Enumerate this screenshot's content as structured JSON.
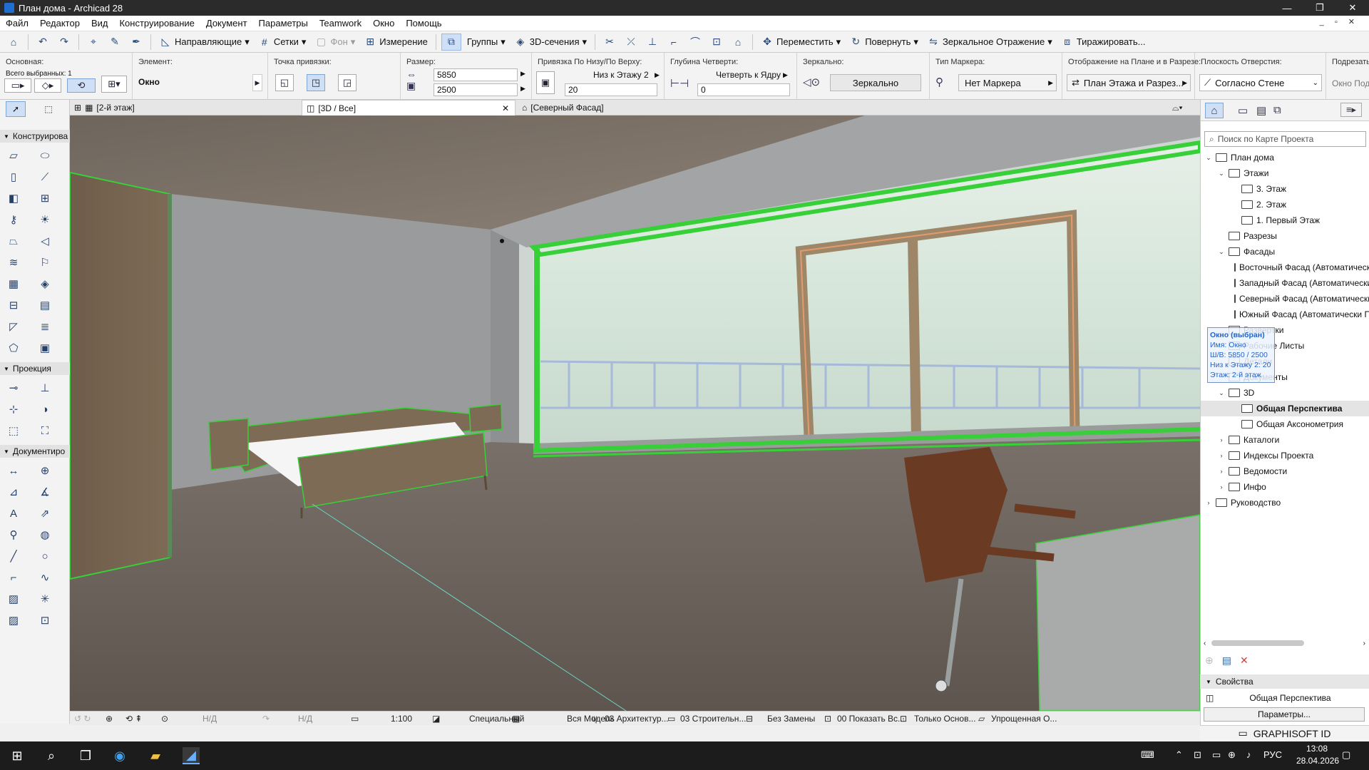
{
  "window": {
    "title": "План дома - Archicad 28",
    "controls": [
      "—",
      "❐",
      "✕"
    ]
  },
  "menu": [
    "Файл",
    "Редактор",
    "Вид",
    "Конструирование",
    "Документ",
    "Параметры",
    "Teamwork",
    "Окно",
    "Помощь"
  ],
  "menu_right": "_ ▫ ✕",
  "toolbar": {
    "guides": "Направляющие",
    "grids": "Сетки",
    "background": "Фон",
    "measure": "Измерение",
    "groups": "Группы",
    "sections3d": "3D-сечения",
    "move": "Переместить",
    "rotate": "Повернуть",
    "mirror": "Зеркальное Отражение",
    "multiply": "Тиражировать..."
  },
  "infobox": {
    "main_label": "Основная:",
    "selected_count": "Всего выбранных: 1",
    "element_label": "Элемент:",
    "element_value": "Окно",
    "snap_label": "Точка привязки:",
    "size_label": "Размер:",
    "width": "5850",
    "height": "2500",
    "anchor_label": "Привязка По Низу/По Верху:",
    "anchor_value": "Низ к Этажу 2",
    "anchor_offset": "20",
    "rebate_label": "Глубина Четверти:",
    "rebate_value": "Четверть к Ядру",
    "rebate_depth": "0",
    "mirror_label": "Зеркально:",
    "mirror_button": "Зеркально",
    "marker_label": "Тип Маркера:",
    "marker_value": "Нет Маркера",
    "display_label": "Отображение на Плане и в Разрезе:",
    "display_value": "План Этажа и Разрез...",
    "opening_label": "Плоскость Отверстия:",
    "opening_value": "Согласно Стене",
    "trim_label": "Подрезать:",
    "trim_value": "Окно Подр"
  },
  "tabs": [
    {
      "label": "[2-й этаж]"
    },
    {
      "label": "[3D / Все]"
    },
    {
      "label": "[Северный Фасад]"
    }
  ],
  "toolbox": {
    "design_section": "Конструирова",
    "view_section": "Проекция",
    "doc_section": "Документиро"
  },
  "statusbar": {
    "na1": "Н/Д",
    "na2": "Н/Д",
    "scale": "1:100",
    "layer": "Специальный",
    "model": "Вся Модель",
    "pen": "03 Архитектур...",
    "structure": "03 Строительн...",
    "override": "Без Замены",
    "renovation": "00 Показать Вс...",
    "only_core": "Только Основ...",
    "simplified": "Упрощенная О..."
  },
  "navigator": {
    "search_placeholder": "Поиск по Карте Проекта",
    "tree": [
      {
        "label": "План дома",
        "level": 0,
        "arrow": "⌄"
      },
      {
        "label": "Этажи",
        "level": 1,
        "arrow": "⌄"
      },
      {
        "label": "3. Этаж",
        "level": 2,
        "arrow": ""
      },
      {
        "label": "2. Этаж",
        "level": 2,
        "arrow": ""
      },
      {
        "label": "1. Первый Этаж",
        "level": 2,
        "arrow": ""
      },
      {
        "label": "Разрезы",
        "level": 1,
        "arrow": ""
      },
      {
        "label": "Фасады",
        "level": 1,
        "arrow": "⌄"
      },
      {
        "label": "Восточный Фасад (Автоматическ",
        "level": 2,
        "arrow": ""
      },
      {
        "label": "Западный Фасад (Автоматически",
        "level": 2,
        "arrow": ""
      },
      {
        "label": "Северный Фасад (Автоматически",
        "level": 2,
        "arrow": ""
      },
      {
        "label": "Южный Фасад (Автоматически П",
        "level": 2,
        "arrow": ""
      },
      {
        "label": "Развертки",
        "level": 1,
        "arrow": ""
      },
      {
        "label": "Рабочие Листы",
        "level": 1,
        "arrow": ""
      },
      {
        "label": "Детали",
        "level": 1,
        "arrow": ""
      },
      {
        "label": "Документы",
        "level": 1,
        "arrow": ""
      },
      {
        "label": "3D",
        "level": 1,
        "arrow": "⌄"
      },
      {
        "label": "Общая Перспектива",
        "level": 2,
        "arrow": "",
        "selected": true
      },
      {
        "label": "Общая Аксонометрия",
        "level": 2,
        "arrow": ""
      },
      {
        "label": "Каталоги",
        "level": 1,
        "arrow": "›"
      },
      {
        "label": "Индексы Проекта",
        "level": 1,
        "arrow": "›"
      },
      {
        "label": "Ведомости",
        "level": 1,
        "arrow": "›"
      },
      {
        "label": "Инфо",
        "level": 1,
        "arrow": "›"
      },
      {
        "label": "Руководство",
        "level": 0,
        "arrow": "›"
      }
    ],
    "tooltip": [
      "Окно (выбран)",
      "Имя: Окно",
      "Ш/В: 5850 / 2500",
      "Низ к Этажу 2: 20",
      "Этаж: 2-й этаж"
    ],
    "properties_label": "Свойства",
    "properties_value": "Общая Перспектива",
    "params_button": "Параметры...",
    "graphisoft_id": "GRAPHISOFT ID"
  },
  "taskbar": {
    "lang": "РУС",
    "time": "13:08",
    "date": "28.04.2026"
  },
  "colors": {
    "selection": "#38d038",
    "window_frame": "#e49b6c",
    "accent": "#2563c5"
  }
}
